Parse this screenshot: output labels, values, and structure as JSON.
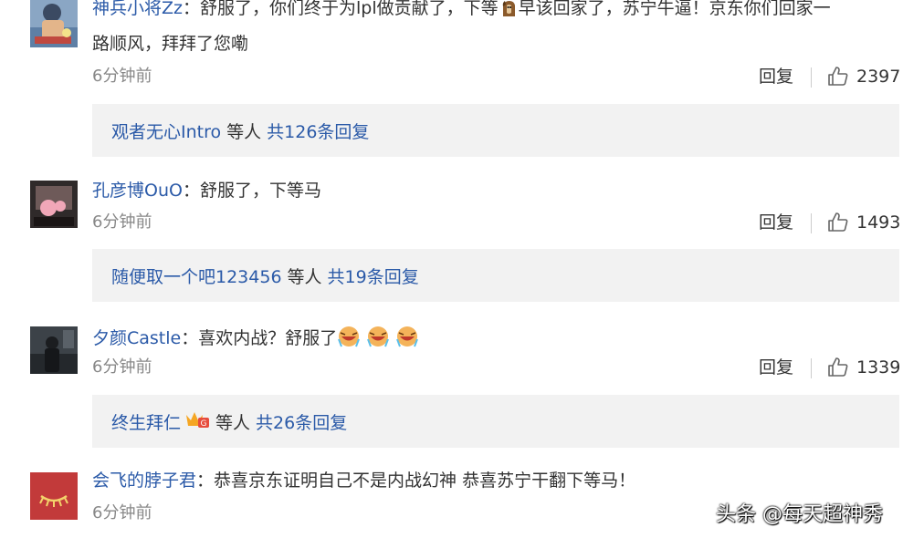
{
  "comments": [
    {
      "username": "神兵小将Zz",
      "text_before_emoji": "舒服了，你们终于为lpl做贡献了，下等",
      "emoji": "horse-emoji",
      "text_after_emoji": "早该回家了，苏宁牛逼！京东你们回家一",
      "text_line2": "路顺风，拜拜了您嘞",
      "time": "6分钟前",
      "reply_label": "回复",
      "likes": "2397",
      "replies": {
        "user": "观者无心Intro",
        "others": "等人",
        "total": "共126条回复"
      }
    },
    {
      "username": "孔彦博OuO",
      "text": "舒服了，下等马",
      "time": "6分钟前",
      "reply_label": "回复",
      "likes": "1493",
      "replies": {
        "user": "随便取一个吧123456",
        "others": "等人",
        "total": "共19条回复"
      }
    },
    {
      "username": "夕颜Castle",
      "text": "喜欢内战？舒服了",
      "emoji": "laugh-cry-emoji",
      "time": "6分钟前",
      "reply_label": "回复",
      "likes": "1339",
      "replies": {
        "user": "终生拜仁",
        "badge": "vip-badge-icon",
        "others": "等人",
        "total": "共26条回复"
      }
    },
    {
      "username": "会飞的脖子君",
      "text": "恭喜京东证明自己不是内战幻神 恭喜苏宁干翻下等马！",
      "time": "6分钟前"
    }
  ],
  "colon": "：",
  "watermark": "头条 @每天超神秀",
  "colors": {
    "link": "#2b5aa8",
    "meta": "#888888",
    "reply_bg": "#f2f2f2"
  }
}
